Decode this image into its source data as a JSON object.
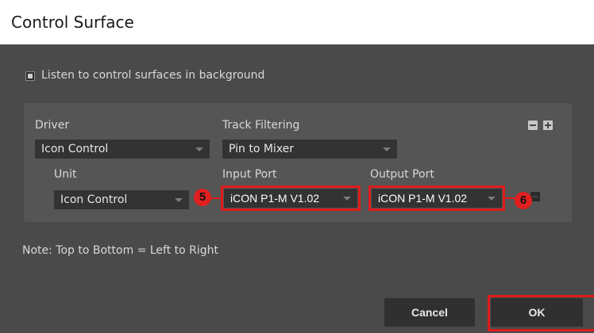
{
  "window": {
    "title": "Control Surface"
  },
  "options": {
    "listen_label": "Listen to control surfaces in background",
    "listen_checked": true
  },
  "panel": {
    "driver_label": "Driver",
    "driver_value": "Icon Control",
    "track_filtering_label": "Track Filtering",
    "track_filtering_value": "Pin to Mixer",
    "unit_label": "Unit",
    "unit_value": "Icon Control",
    "input_port_label": "Input Port",
    "input_port_value": "iCON P1-M V1.02",
    "output_port_label": "Output Port",
    "output_port_value": "iCON P1-M V1.02"
  },
  "annotations": {
    "badge_5": "5",
    "badge_6": "6",
    "highlight_color": "#e01b1b"
  },
  "note": "Note: Top to Bottom = Left to Right",
  "buttons": {
    "cancel": "Cancel",
    "ok": "OK"
  },
  "icons": {
    "remove": "minus-icon",
    "add": "plus-icon",
    "dropdown": "chevron-down-icon"
  }
}
